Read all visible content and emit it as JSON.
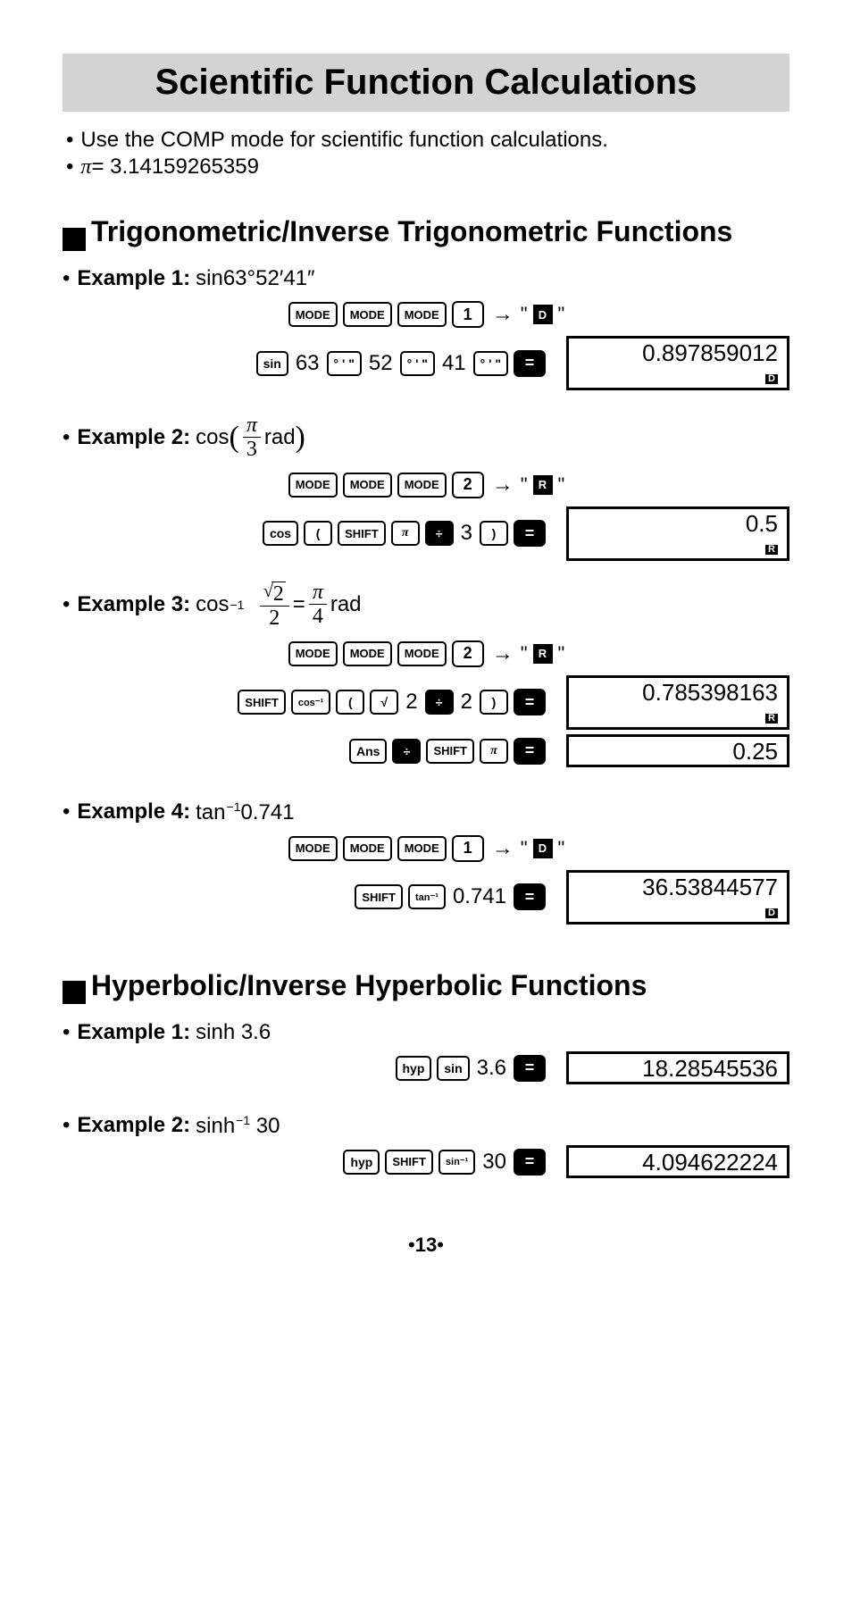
{
  "title": "Scientific Function Calculations",
  "intro": {
    "b1": "Use the COMP mode for scientific function calculations.",
    "pi_symbol": "π",
    "pi_value": " = 3.14159265359"
  },
  "sections": {
    "trig": {
      "heading": "Trigonometric/Inverse Trigonometric Functions",
      "ex1": {
        "label": "Example 1:",
        "expr_pre": " sin63",
        "deg": "°",
        "m": "52",
        "mtick": "′",
        "s": "41",
        "stick": "″",
        "mode_key": "MODE",
        "one": "1",
        "d_ind": "D",
        "sin_key": "sin",
        "v63": "63",
        "dms_key": "° ' \"",
        "v52": "52",
        "v41": "41",
        "eq_key": "=",
        "result": "0.897859012",
        "result_mode": "D"
      },
      "ex2": {
        "label": "Example 2:",
        "cos_text": " cos ",
        "pi": "π",
        "three": "3",
        "rad_text": " rad",
        "two_key": "2",
        "r_ind": "R",
        "cos_key": "cos",
        "paren_l": "(",
        "shift_key": "SHIFT",
        "pi_key": "π",
        "div_key": "÷",
        "v3": "3",
        "paren_r": ")",
        "result": "0.5",
        "result_mode": "R"
      },
      "ex3": {
        "label": "Example 3:",
        "cos_text": " cos",
        "inv": "−1",
        "sqrt2": "2",
        "den2": "2",
        "eq": " = ",
        "pi": "π",
        "four": "4",
        "rad": " rad",
        "two_key": "2",
        "r_ind": "R",
        "shift_key": "SHIFT",
        "cosinv_key": "cos⁻¹",
        "paren_l": "(",
        "sqrt_key": "√",
        "v2a": "2",
        "div_key": "÷",
        "v2b": "2",
        "paren_r": ")",
        "result1": "0.785398163",
        "result1_mode": "R",
        "ans_key": "Ans",
        "pi_key": "π",
        "result2": "0.25"
      },
      "ex4": {
        "label": "Example 4:",
        "expr": " tan",
        "inv": "−1",
        "val": "0.741",
        "one_key": "1",
        "d_ind": "D",
        "shift_key": "SHIFT",
        "taninv_key": "tan⁻¹",
        "v": "0.741",
        "result": "36.53844577",
        "result_mode": "D"
      }
    },
    "hyp": {
      "heading": "Hyperbolic/Inverse Hyperbolic Functions",
      "ex1": {
        "label": "Example 1:",
        "expr": " sinh 3.6",
        "hyp_key": "hyp",
        "sin_key": "sin",
        "v": "3.6",
        "result": "18.28545536"
      },
      "ex2": {
        "label": "Example 2:",
        "expr_pre": " sinh",
        "inv": "−1",
        "expr_post": " 30",
        "hyp_key": "hyp",
        "shift_key": "SHIFT",
        "sininv_key": "sin⁻¹",
        "v": "30",
        "result": "4.094622224"
      }
    }
  },
  "page": "13",
  "common": {
    "mode_key": "MODE",
    "eq_key": "="
  }
}
